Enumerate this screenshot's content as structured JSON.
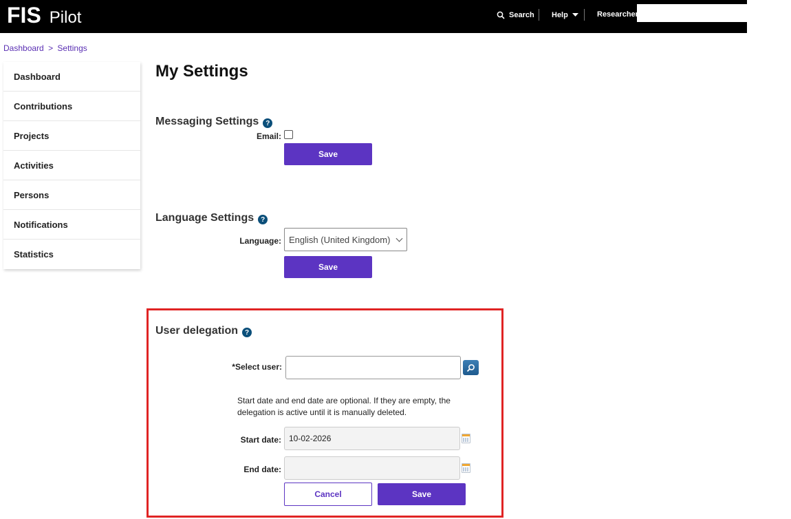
{
  "header": {
    "logo_main": "FIS",
    "logo_sub": "Pilot",
    "search_label": "Search",
    "help_label": "Help",
    "user_label": "Researcher"
  },
  "breadcrumb": {
    "items": [
      "Dashboard",
      "Settings"
    ],
    "separator": ">"
  },
  "sidebar": {
    "items": [
      {
        "label": "Dashboard"
      },
      {
        "label": "Contributions"
      },
      {
        "label": "Projects"
      },
      {
        "label": "Activities"
      },
      {
        "label": "Persons"
      },
      {
        "label": "Notifications"
      },
      {
        "label": "Statistics"
      }
    ]
  },
  "page": {
    "title": "My Settings"
  },
  "messaging": {
    "title": "Messaging Settings",
    "help": "?",
    "email_label": "Email:",
    "email_checked": false,
    "save_label": "Save"
  },
  "language": {
    "title": "Language Settings",
    "help": "?",
    "language_label": "Language:",
    "selected": "English (United Kingdom)",
    "save_label": "Save"
  },
  "delegation": {
    "title": "User delegation",
    "help": "?",
    "select_user_label": "*Select user:",
    "select_user_value": "",
    "note": "Start date and end date are optional. If they are empty, the delegation is active until it is manually deleted.",
    "start_date_label": "Start date:",
    "start_date_value": "10-02-2026",
    "end_date_label": "End date:",
    "end_date_value": "",
    "cancel_label": "Cancel",
    "save_label": "Save"
  },
  "colors": {
    "accent": "#5c34c2",
    "highlight_border": "#e02424",
    "header_bg": "#000000",
    "help_icon": "#0b4f7a"
  }
}
